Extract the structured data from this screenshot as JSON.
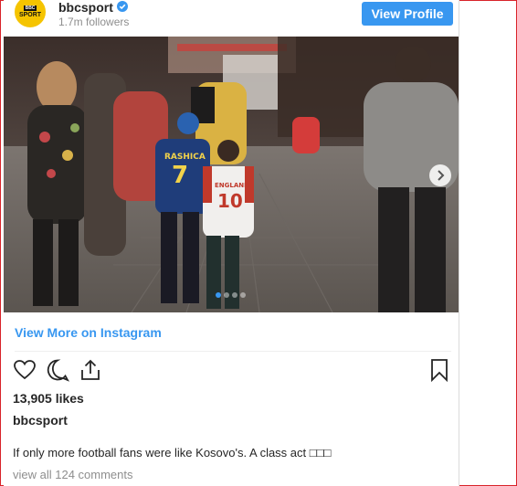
{
  "post": {
    "avatar_bbc": "BBC",
    "avatar_sport": "SPORT",
    "username": "bbcsport",
    "followers": "1.7m followers",
    "view_profile": "View Profile",
    "photo_description_icon": "photo",
    "shirt_left_name": "RASHICA",
    "shirt_left_number": "7",
    "shirt_right_name": "ENGLAND",
    "shirt_right_number": "10",
    "carousel": {
      "total": 4,
      "active": 1
    },
    "view_more": "View More on Instagram",
    "likes": "13,905 likes",
    "caption_user": "bbcsport",
    "caption": "If only more football fans were like Kosovo's. A class act □□□",
    "comments": "view all 124 comments"
  },
  "colors": {
    "accent": "#3897f0",
    "frame": "#d8232a",
    "avatar": "#f5c400"
  },
  "icons": [
    "verified-icon",
    "chevron-right-icon",
    "heart-icon",
    "comment-icon",
    "share-icon",
    "bookmark-icon"
  ]
}
